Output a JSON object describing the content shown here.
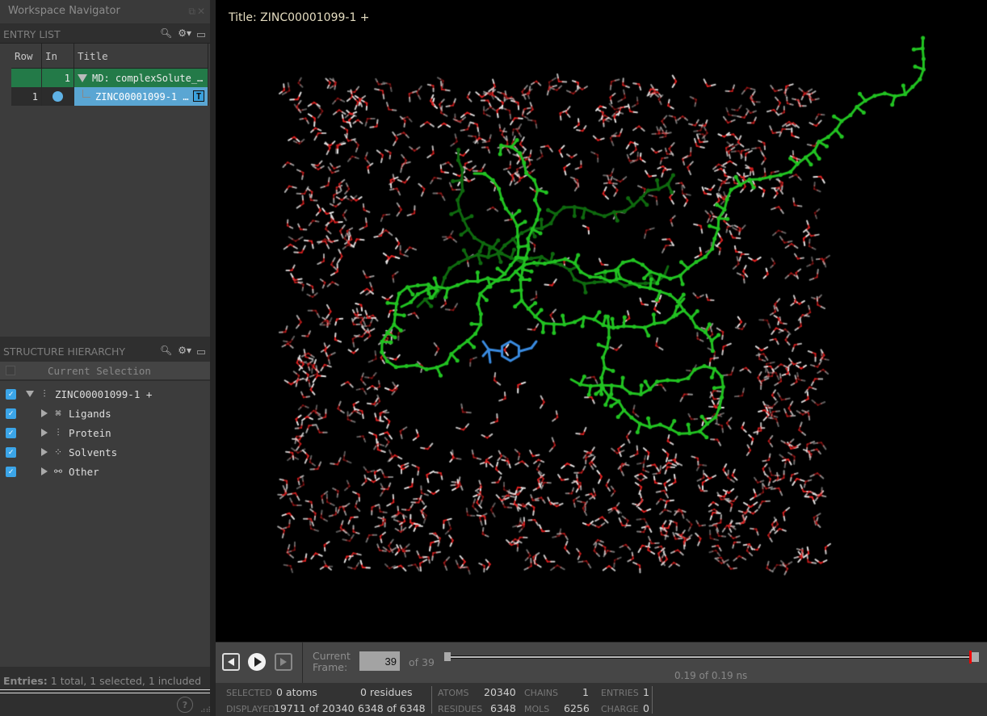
{
  "navigator": {
    "title": "Workspace Navigator",
    "window_buttons": [
      "restore-icon",
      "close-icon"
    ],
    "entry_list": {
      "header": "ENTRY LIST",
      "columns": [
        "Row",
        "In",
        "Title"
      ],
      "group": {
        "in": "1",
        "title": "MD: complexSolute_…"
      },
      "entries": [
        {
          "row": "1",
          "included": true,
          "title": "ZINC00001099-1 …",
          "badge": "T"
        }
      ]
    },
    "structure_hierarchy": {
      "header": "STRUCTURE HIERARCHY",
      "current_selection": "Current Selection",
      "root": {
        "label": "ZINC00001099-1 +",
        "checked": true,
        "icon": "molecule-icon"
      },
      "children": [
        {
          "label": "Ligands",
          "checked": true,
          "icon": "ligand-icon"
        },
        {
          "label": "Protein",
          "checked": true,
          "icon": "protein-helix-icon"
        },
        {
          "label": "Solvents",
          "checked": true,
          "icon": "solvent-dots-icon"
        },
        {
          "label": "Other",
          "checked": true,
          "icon": "other-nodes-icon"
        }
      ]
    },
    "status": {
      "label": "Entries:",
      "text": "1 total, 1 selected, 1 included"
    },
    "help": "?"
  },
  "viewer": {
    "title": "Title: ZINC00001099-1 +",
    "colors": {
      "background": "#000000",
      "protein": "#22c322",
      "ligand": "#3a8be0",
      "oxygen": "#e02020",
      "hydrogen": "#e8e8e8"
    }
  },
  "playback": {
    "frame_label_1": "Current",
    "frame_label_2": "Frame:",
    "current_frame": "39",
    "of_text": "of 39",
    "position_fraction": 1.0,
    "time_text": "0.19 of 0.19 ns"
  },
  "status_bar": {
    "selected_label": "SELECTED",
    "selected_atoms": "0 atoms",
    "selected_residues": "0 residues",
    "displayed_label": "DISPLAYED",
    "displayed_atoms": "19711 of 20340",
    "displayed_residues": "6348 of 6348",
    "atoms_label": "ATOMS",
    "atoms": "20340",
    "residues_label": "RESIDUES",
    "residues": "6348",
    "chains_label": "CHAINS",
    "chains": "1",
    "mols_label": "MOLS",
    "mols": "6256",
    "entries_label": "ENTRIES",
    "entries": "1",
    "charge_label": "CHARGE",
    "charge": "0"
  }
}
